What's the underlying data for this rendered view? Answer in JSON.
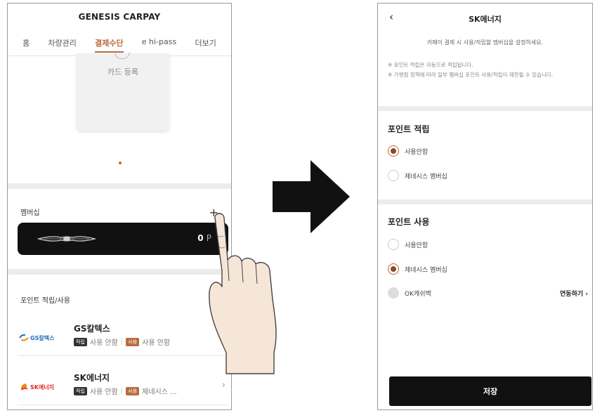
{
  "left": {
    "app_title": "GENESIS CARPAY",
    "tabs": [
      {
        "label": "홈",
        "active": false
      },
      {
        "label": "차량관리",
        "active": false
      },
      {
        "label": "결제수단",
        "active": true
      },
      {
        "label": "e hi-pass",
        "active": false
      },
      {
        "label": "더보기",
        "active": false
      }
    ],
    "card_register_label": "카드 등록",
    "membership_title": "멤버십",
    "plus_label": "+",
    "member_points": "0",
    "member_points_unit": "P",
    "point_section_title": "포인트 적립/사용",
    "brands": [
      {
        "name": "GS칼텍스",
        "logo_text": "GS칼텍스",
        "earn_badge": "적립",
        "earn_value": "사용 안함",
        "use_badge": "사용",
        "use_value": "사용 안함"
      },
      {
        "name": "SK에너지",
        "logo_text": "SK에너지",
        "earn_badge": "적립",
        "earn_value": "사용 안함",
        "use_badge": "사용",
        "use_value": "제네시스 ..."
      }
    ]
  },
  "right": {
    "back_label": "‹",
    "title": "SK에너지",
    "info": "카페이 결제 시 사용/적립할 멤버십을 설정하세요.",
    "notes": [
      "※ 포인트 적립은 자동으로 적립됩니다.",
      "※ 가맹점 정책에 따라 일부 멤버십 포인트 사용/적립이 제한될 수 있습니다."
    ],
    "earn_section": "포인트 적립",
    "earn_options": [
      {
        "label": "사용안함",
        "selected": true
      },
      {
        "label": "제네시스 멤버십",
        "selected": false
      }
    ],
    "use_section": "포인트 사용",
    "use_options": [
      {
        "label": "사용안함",
        "selected": false
      },
      {
        "label": "제네시스 멤버십",
        "selected": true
      }
    ],
    "ok_option": {
      "label": "OK캐쉬백",
      "link": "연동하기 ›"
    },
    "save_label": "저장"
  },
  "colors": {
    "accent": "#b86b3c",
    "radio_fill": "#8c4a2a",
    "dark": "#111111"
  }
}
